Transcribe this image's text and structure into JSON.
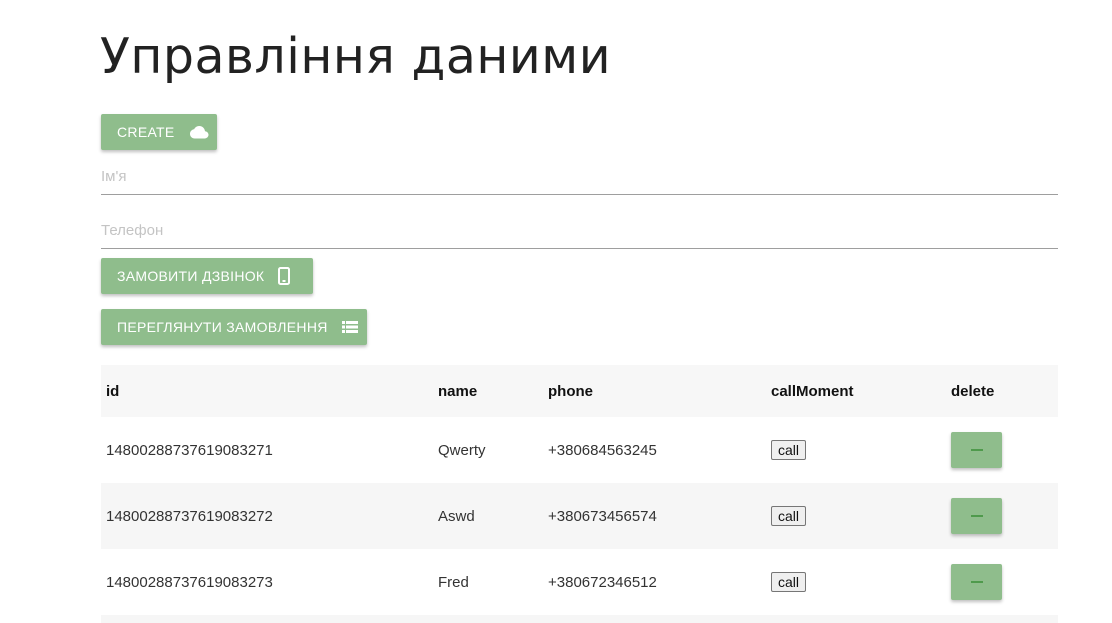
{
  "page": {
    "title": "Управління даними"
  },
  "buttons": {
    "create_label": "CREATE",
    "create_icon": "cloud-icon",
    "call_label": "ЗАМОВИТИ ДЗВІНОК",
    "call_icon": "phone-icon",
    "orders_label": "ПЕРЕГЛЯНУТИ ЗАМОВЛЕННЯ",
    "orders_icon": "list-icon"
  },
  "form": {
    "name_placeholder": "Ім'я",
    "name_value": "",
    "phone_placeholder": "Телефон",
    "phone_value": ""
  },
  "table": {
    "headers": {
      "id": "id",
      "name": "name",
      "phone": "phone",
      "callMoment": "callMoment",
      "delete": "delete"
    },
    "rows": [
      {
        "id": "14800288737619083271",
        "name": "Qwerty",
        "phone": "+380684563245",
        "call_label": "call"
      },
      {
        "id": "14800288737619083272",
        "name": "Aswd",
        "phone": "+380673456574",
        "call_label": "call"
      },
      {
        "id": "14800288737619083273",
        "name": "Fred",
        "phone": "+380672346512",
        "call_label": "call"
      }
    ]
  },
  "colors": {
    "accent": "#8fbd8c",
    "minus_icon": "#4f9a4c",
    "header_bg": "#f7f7f7",
    "stripe_bg": "#f6f6f6"
  }
}
